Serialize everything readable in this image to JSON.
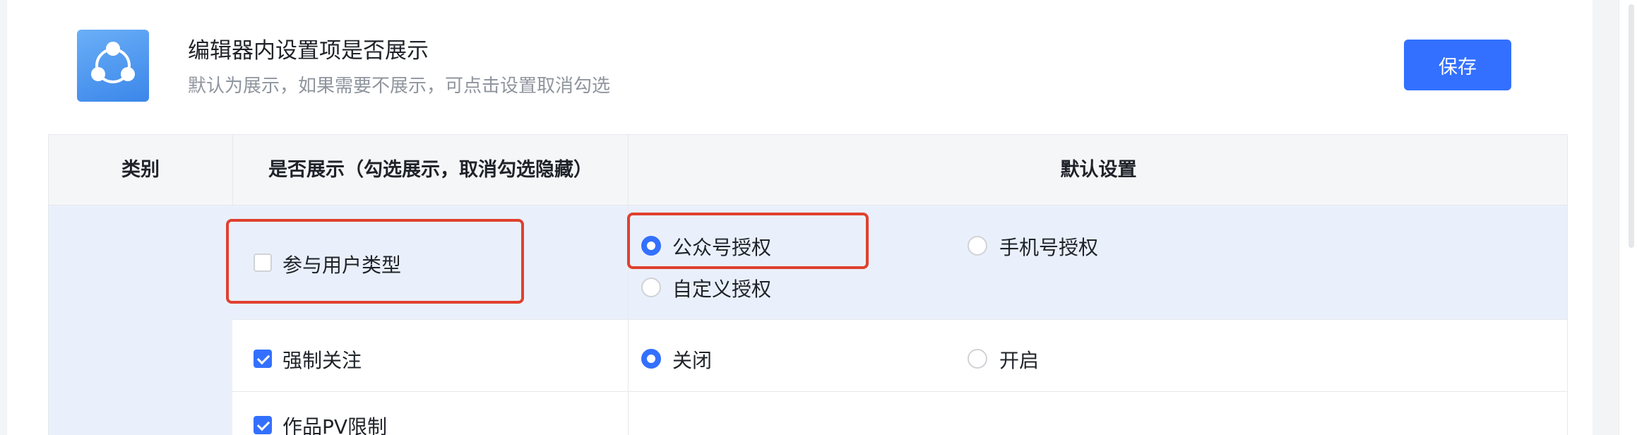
{
  "header": {
    "icon": "share-nodes-icon",
    "title": "编辑器内设置项是否展示",
    "subtitle": "默认为展示，如果需要不展示，可点击设置取消勾选",
    "save_label": "保存"
  },
  "table": {
    "headers": {
      "category": "类别",
      "show": "是否展示（勾选展示，取消勾选隐藏）",
      "default": "默认设置"
    },
    "rows": [
      {
        "label": "参与用户类型",
        "checked": false,
        "options": [
          {
            "label": "公众号授权",
            "selected": true
          },
          {
            "label": "手机号授权",
            "selected": false
          },
          {
            "label": "自定义授权",
            "selected": false
          }
        ]
      },
      {
        "label": "强制关注",
        "checked": true,
        "options": [
          {
            "label": "关闭",
            "selected": true
          },
          {
            "label": "开启",
            "selected": false
          }
        ]
      },
      {
        "label": "作品PV限制",
        "checked": true,
        "options": []
      }
    ]
  },
  "colors": {
    "accent": "#3370ff",
    "highlight": "#e0412f",
    "row_highlight_bg": "#eaf0fb"
  }
}
